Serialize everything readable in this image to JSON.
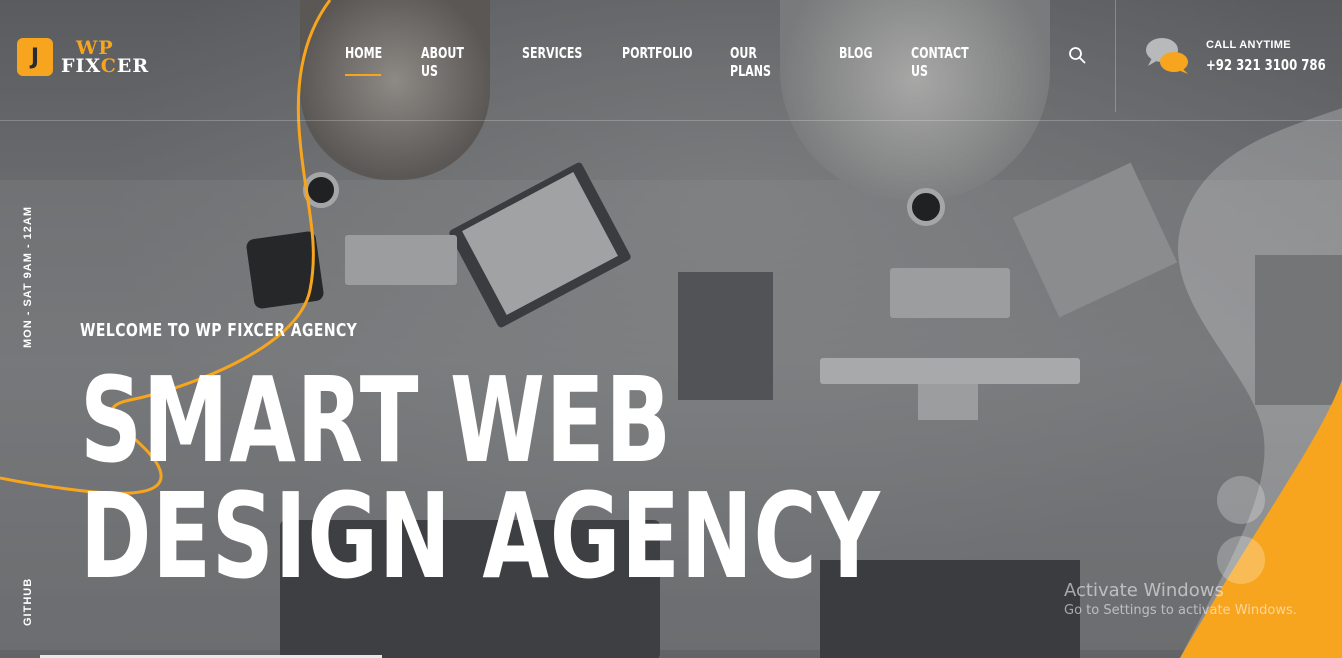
{
  "brand": {
    "logo_icon_glyph": "J",
    "logo_line1": "WP",
    "logo_line2_a": "FIX",
    "logo_line2_b": "C",
    "logo_line2_c": "ER",
    "accent_color": "#f7a51e"
  },
  "nav": {
    "items": [
      {
        "label": "HOME",
        "active": true
      },
      {
        "label": "ABOUT US",
        "active": false
      },
      {
        "label": "SERVICES",
        "active": false
      },
      {
        "label": "PORTFOLIO",
        "active": false
      },
      {
        "label": "OUR PLANS",
        "active": false
      },
      {
        "label": "BLOG",
        "active": false
      },
      {
        "label": "CONTACT US",
        "active": false
      }
    ]
  },
  "header": {
    "search_icon": "search-icon",
    "chat_icon": "chat-bubbles-icon",
    "call_label": "CALL ANYTIME",
    "call_number": "+92 321 3100 786"
  },
  "side": {
    "hours": "MON - SAT   9AM - 12AM",
    "github": "GITHUB"
  },
  "hero": {
    "welcome": "WELCOME TO WP FIXCER AGENCY",
    "headline_line1": "SMART WEB",
    "headline_line2": "DESIGN AGENCY"
  },
  "os_watermark": {
    "title": "Activate Windows",
    "subtitle": "Go to Settings to activate Windows."
  }
}
